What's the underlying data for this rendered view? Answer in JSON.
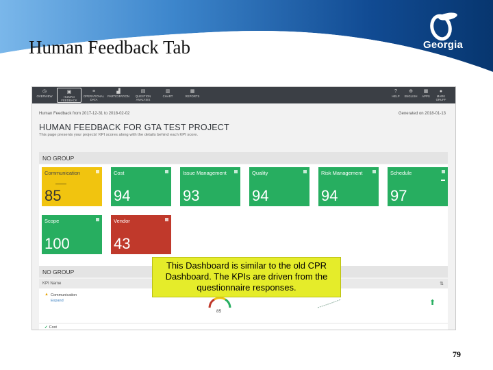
{
  "slide": {
    "title": "Human Feedback Tab",
    "page_number": "79",
    "callout_text": "This Dashboard is similar to the old CPR Dashboard.  The KPIs are driven from the questionnaire responses.",
    "logo_text": "Georgia"
  },
  "app": {
    "nav_left": [
      {
        "icon": "clock-icon",
        "glyph": "◷",
        "label": "OVERVIEW"
      },
      {
        "icon": "feedback-icon",
        "glyph": "▣",
        "label": "HUMAN FEEDBACK",
        "active": true
      },
      {
        "icon": "data-icon",
        "glyph": "≡",
        "label": "OPERATIONAL DATA"
      },
      {
        "icon": "chart-icon",
        "glyph": "▟",
        "label": "PARTICIPATION"
      },
      {
        "icon": "question-icon",
        "glyph": "▤",
        "label": "QUESTION ANALYSIS"
      },
      {
        "icon": "chart-icon",
        "glyph": "▥",
        "label": "CHART"
      },
      {
        "icon": "reports-icon",
        "glyph": "▦",
        "label": "REPORTS"
      }
    ],
    "nav_right": [
      {
        "icon": "help-icon",
        "glyph": "?",
        "label": "HELP"
      },
      {
        "icon": "globe-icon",
        "glyph": "⊕",
        "label": "ENGLISH"
      },
      {
        "icon": "apps-icon",
        "glyph": "▦",
        "label": "APPS"
      },
      {
        "icon": "user-icon",
        "glyph": "●",
        "label": "MARK GRUFF"
      }
    ],
    "breadcrumb": "Human Feedback from 2017-12-31 to 2018-02-02",
    "generated": "Generated on 2018-01-13",
    "project_title": "HUMAN FEEDBACK FOR GTA TEST PROJECT",
    "project_subtitle": "This page presents your projects' KPI scores along with the details behind each KPI score.",
    "group1_label": "NO GROUP",
    "tiles": [
      {
        "name": "Communication",
        "value": "85",
        "color": "yellow"
      },
      {
        "name": "Cost",
        "value": "94",
        "color": "green"
      },
      {
        "name": "Issue Management",
        "value": "93",
        "color": "green"
      },
      {
        "name": "Quality",
        "value": "94",
        "color": "green"
      },
      {
        "name": "Risk Management",
        "value": "94",
        "color": "green"
      },
      {
        "name": "Schedule",
        "value": "97",
        "color": "green"
      },
      {
        "name": "Scope",
        "value": "100",
        "color": "green"
      },
      {
        "name": "Vendor",
        "value": "43",
        "color": "red"
      }
    ],
    "group2_label": "NO GROUP",
    "table_header": "KPI Name",
    "rows": {
      "communication_name": "Communication",
      "expand_label": "Expand",
      "gauge_value": "85",
      "cost_name": "Cost"
    }
  },
  "colors": {
    "green": "#27ae60",
    "yellow": "#f1c40f",
    "red": "#c0392b",
    "nav": "#3b3f45",
    "callout": "#e5ec2a",
    "band": "#0a3e8c"
  }
}
